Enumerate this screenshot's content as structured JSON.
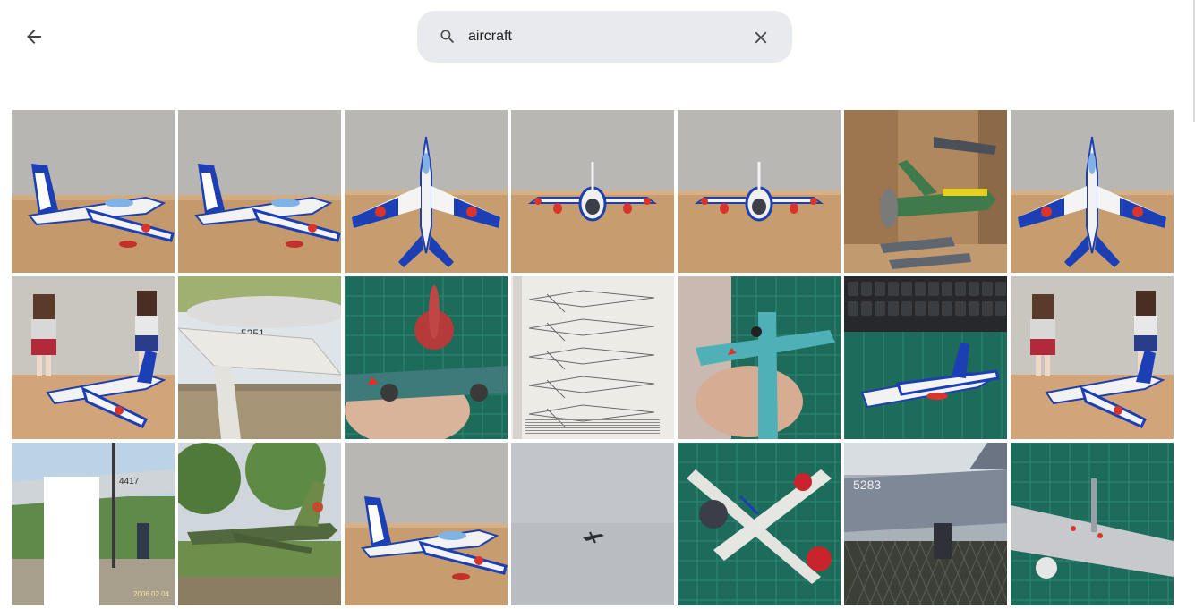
{
  "header": {
    "back_icon": "arrow-left-icon",
    "search": {
      "icon": "search-icon",
      "value": "aircraft",
      "clear_icon": "close-icon"
    }
  },
  "photos": [
    {
      "scene": "table-side",
      "subject": "blue-jet-side"
    },
    {
      "scene": "table-side",
      "subject": "blue-jet-side"
    },
    {
      "scene": "table",
      "subject": "blue-jet-top"
    },
    {
      "scene": "table",
      "subject": "blue-jet-front"
    },
    {
      "scene": "table",
      "subject": "blue-jet-front"
    },
    {
      "scene": "shelf",
      "subject": "green-prop-plane"
    },
    {
      "scene": "table",
      "subject": "blue-jet-top"
    },
    {
      "scene": "table-figures",
      "subject": "blue-jet-figures"
    },
    {
      "scene": "outdoor-sky",
      "subject": "white-wing"
    },
    {
      "scene": "mat",
      "subject": "green-prop-hand"
    },
    {
      "scene": "paper",
      "subject": "instruction-sheet"
    },
    {
      "scene": "mat",
      "subject": "teal-prop-hand"
    },
    {
      "scene": "mat-keyboard",
      "subject": "blue-jet-mat"
    },
    {
      "scene": "table-figures",
      "subject": "blue-jet-figures"
    },
    {
      "scene": "outdoor-park",
      "subject": "jet-on-pole"
    },
    {
      "scene": "outdoor-trees",
      "subject": "camo-jet"
    },
    {
      "scene": "table",
      "subject": "blue-jet-side"
    },
    {
      "scene": "grey-sky",
      "subject": "distant-plane"
    },
    {
      "scene": "mat",
      "subject": "zero-fighter"
    },
    {
      "scene": "outdoor-fence",
      "subject": "grey-jet"
    },
    {
      "scene": "mat",
      "subject": "silver-plane-closeup"
    }
  ],
  "printed_text": {
    "jet_pole_number": "4417",
    "jet_pole_date": "2006.02.04",
    "wing_number": "5251",
    "grey_jet_number": "5283"
  },
  "colors": {
    "search_bg": "#e9eaee",
    "icon": "#444746",
    "text": "#1f1f1f"
  }
}
